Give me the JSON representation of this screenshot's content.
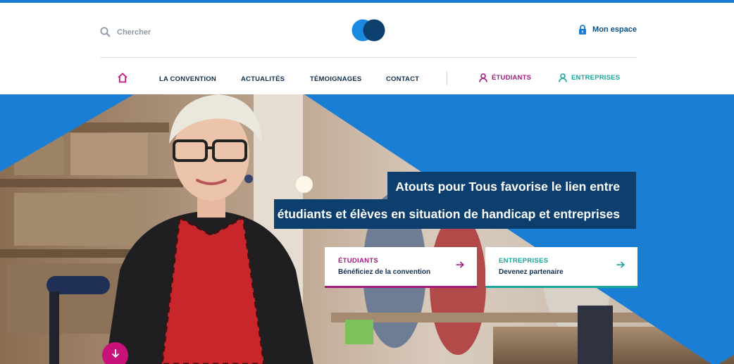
{
  "header": {
    "search_placeholder": "Chercher",
    "account_label": "Mon espace"
  },
  "nav": {
    "items": [
      "LA CONVENTION",
      "ACTUALITÉS",
      "TÉMOIGNAGES",
      "CONTACT"
    ],
    "student_label": "ÉTUDIANTS",
    "company_label": "ENTREPRISES"
  },
  "hero": {
    "headline_line1": "Atouts pour Tous favorise le lien entre",
    "headline_line2": "étudiants et élèves en situation de handicap et entreprises",
    "card_students": {
      "title": "ÉTUDIANTS",
      "subtitle": "Bénéficiez de la convention"
    },
    "card_companies": {
      "title": "ENTREPRISES",
      "subtitle": "Devenez partenaire"
    }
  },
  "colors": {
    "primary_blue": "#1a7fd4",
    "navy": "#0d3f6e",
    "magenta": "#a3197d",
    "teal": "#1aa69a",
    "scroll_button": "#c8127a"
  },
  "icons": [
    "search-icon",
    "lock-icon",
    "home-icon",
    "user-icon",
    "arrow-right-icon",
    "arrow-down-icon"
  ]
}
